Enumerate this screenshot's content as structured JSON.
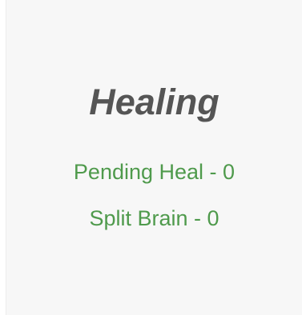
{
  "healing_card": {
    "title": "Healing",
    "pending_heal": "Pending Heal - 0",
    "split_brain": "Split Brain - 0",
    "stat_color": "#4f9a4c",
    "title_color": "#555555"
  }
}
